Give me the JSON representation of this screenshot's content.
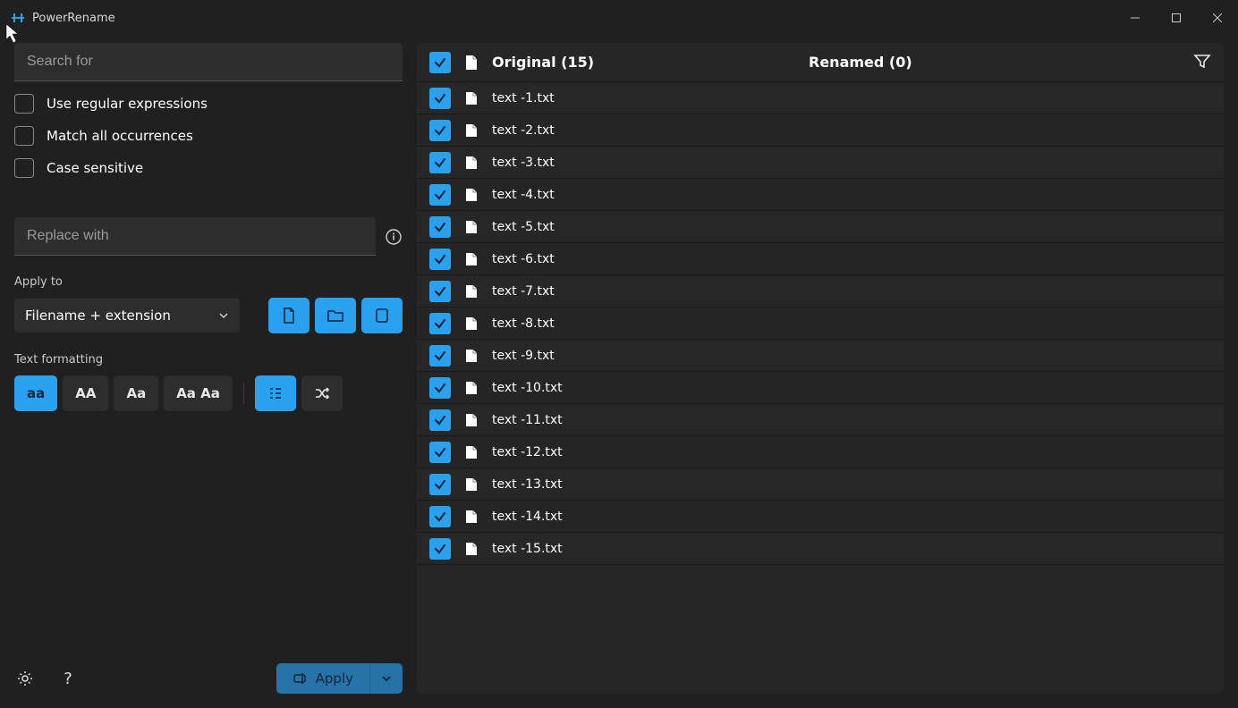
{
  "app": {
    "title": "PowerRename"
  },
  "left": {
    "search_placeholder": "Search for",
    "regex_label": "Use regular expressions",
    "matchall_label": "Match all occurrences",
    "case_label": "Case sensitive",
    "replace_placeholder": "Replace with",
    "apply_to_label": "Apply to",
    "apply_to_value": "Filename + extension",
    "text_formatting_label": "Text formatting",
    "fmt_lower": "aa",
    "fmt_upper": "AA",
    "fmt_title": "Aa",
    "fmt_capitalize": "Aa Aa",
    "apply_button": "Apply"
  },
  "list": {
    "original_header": "Original (15)",
    "renamed_header": "Renamed (0)",
    "items": [
      {
        "name": "text -1.txt"
      },
      {
        "name": "text -2.txt"
      },
      {
        "name": "text -3.txt"
      },
      {
        "name": "text -4.txt"
      },
      {
        "name": "text -5.txt"
      },
      {
        "name": "text -6.txt"
      },
      {
        "name": "text -7.txt"
      },
      {
        "name": "text -8.txt"
      },
      {
        "name": "text -9.txt"
      },
      {
        "name": "text -10.txt"
      },
      {
        "name": "text -11.txt"
      },
      {
        "name": "text -12.txt"
      },
      {
        "name": "text -13.txt"
      },
      {
        "name": "text -14.txt"
      },
      {
        "name": "text -15.txt"
      }
    ]
  }
}
